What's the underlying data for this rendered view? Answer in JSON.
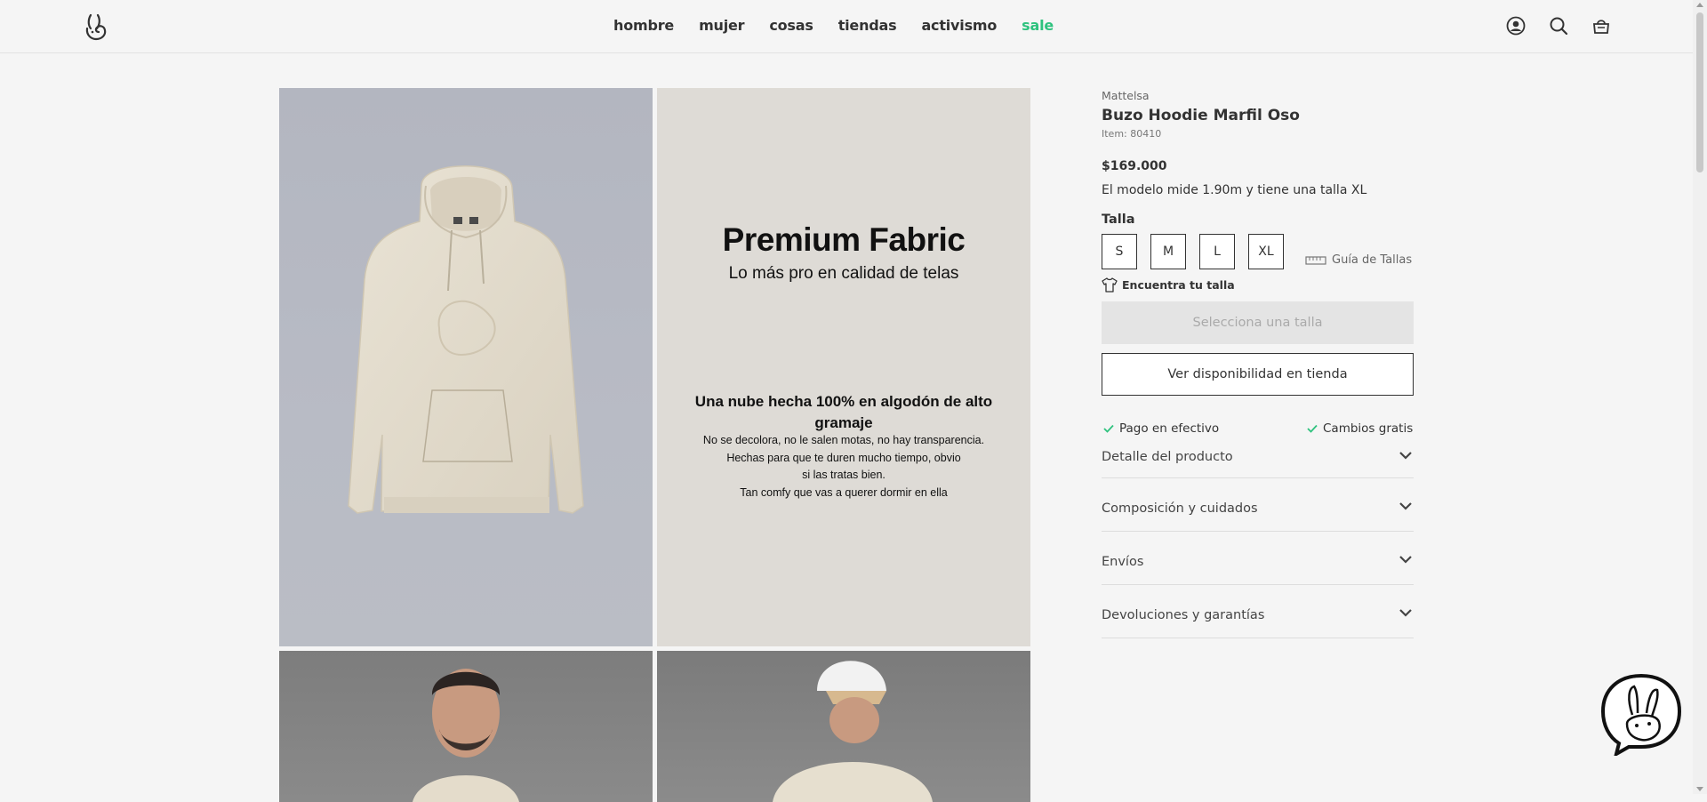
{
  "nav": {
    "links": [
      "hombre",
      "mujer",
      "cosas",
      "tiendas",
      "activismo",
      "sale"
    ]
  },
  "header_icons": [
    "user-icon",
    "search-icon",
    "bag-icon"
  ],
  "gallery": {
    "promo": {
      "title": "Premium Fabric",
      "subtitle": "Lo más pro en calidad de telas",
      "heading": "Una nube hecha 100% en algodón de alto gramaje",
      "lines": [
        "No se decolora, no le salen motas, no hay transparencia.",
        "Hechas para que te duren mucho tiempo, obvio",
        "si las tratas bien.",
        "Tan comfy que vas a querer dormir en ella"
      ]
    }
  },
  "product": {
    "brand": "Mattelsa",
    "title": "Buzo Hoodie Marfil Oso",
    "item": "Item: 80410",
    "price": "$169.000",
    "model_note": "El modelo mide 1.90m y tiene una talla XL",
    "size_label": "Talla",
    "sizes": [
      "S",
      "M",
      "L",
      "XL"
    ],
    "size_guide": "Guía de Tallas",
    "find_size": "Encuentra tu talla",
    "select_button": "Selecciona una talla",
    "store_button": "Ver disponibilidad en tienda",
    "perks": [
      "Pago en efectivo",
      "Cambios gratis"
    ],
    "accordions": [
      "Detalle del producto",
      "Composición y cuidados",
      "Envíos",
      "Devoluciones y garantías"
    ]
  },
  "colors": {
    "sale": "#2ec27e",
    "check": "#2ec27e",
    "text": "#333333"
  }
}
